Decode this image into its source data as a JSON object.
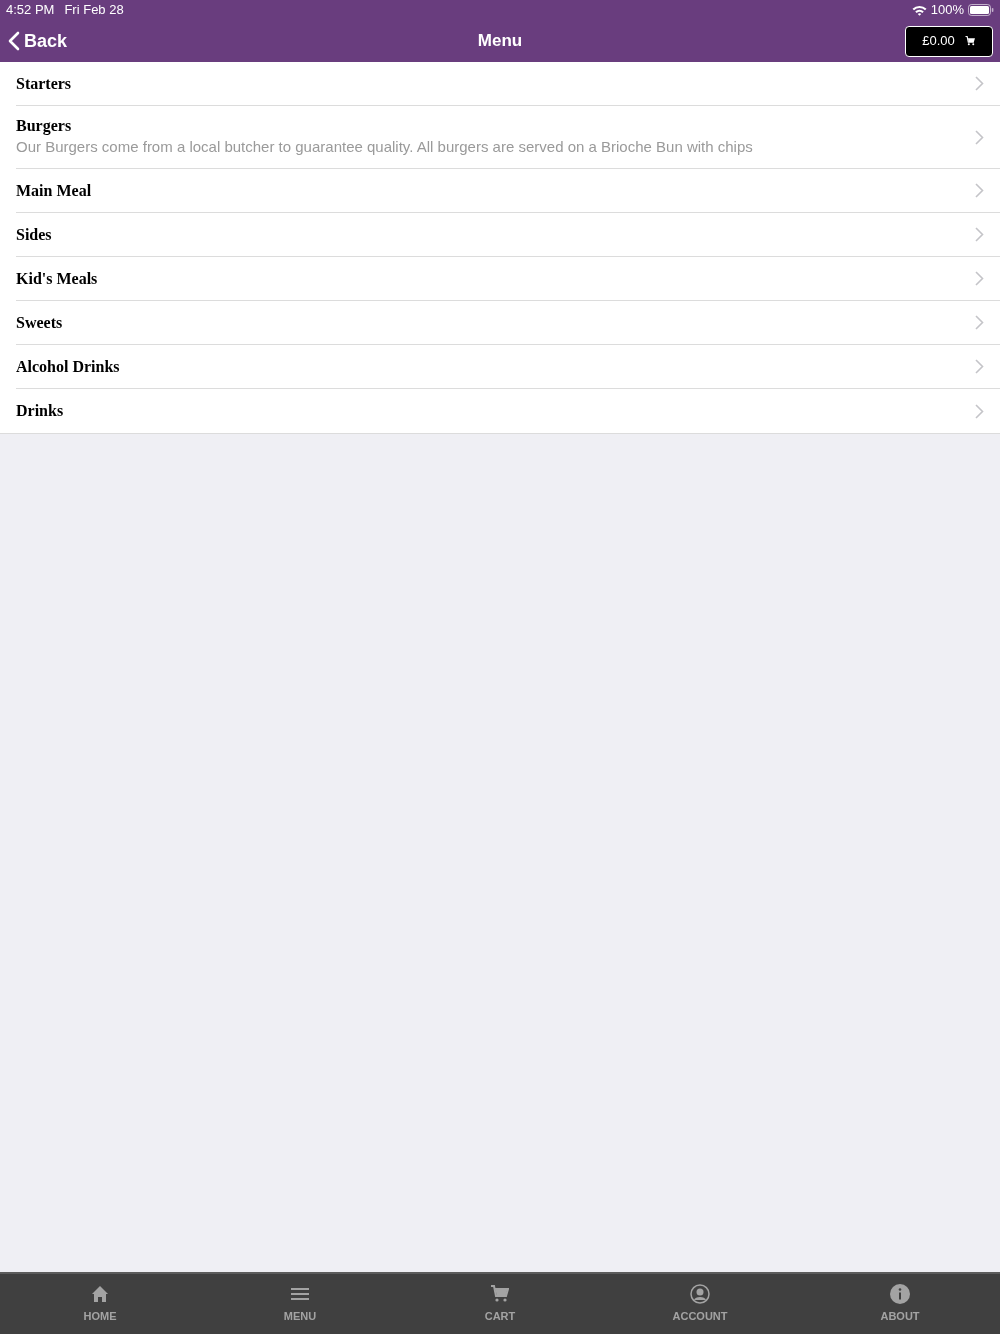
{
  "status_bar": {
    "time": "4:52 PM",
    "date": "Fri Feb 28",
    "battery": "100%"
  },
  "nav_bar": {
    "back": "Back",
    "title": "Menu",
    "cart_total": "£0.00"
  },
  "categories": [
    {
      "name": "Starters"
    },
    {
      "name": "Burgers",
      "description": "Our Burgers come from a local butcher to guarantee quality. All burgers are served on a Brioche Bun with chips"
    },
    {
      "name": "Main Meal"
    },
    {
      "name": "Sides"
    },
    {
      "name": "Kid's Meals"
    },
    {
      "name": "Sweets"
    },
    {
      "name": "Alcohol Drinks"
    },
    {
      "name": "Drinks"
    }
  ],
  "tab_bar": [
    {
      "label": "HOME",
      "kind": "home"
    },
    {
      "label": "MENU",
      "kind": "menu"
    },
    {
      "label": "CART",
      "kind": "cart"
    },
    {
      "label": "ACCOUNT",
      "kind": "account"
    },
    {
      "label": "ABOUT",
      "kind": "about"
    }
  ]
}
